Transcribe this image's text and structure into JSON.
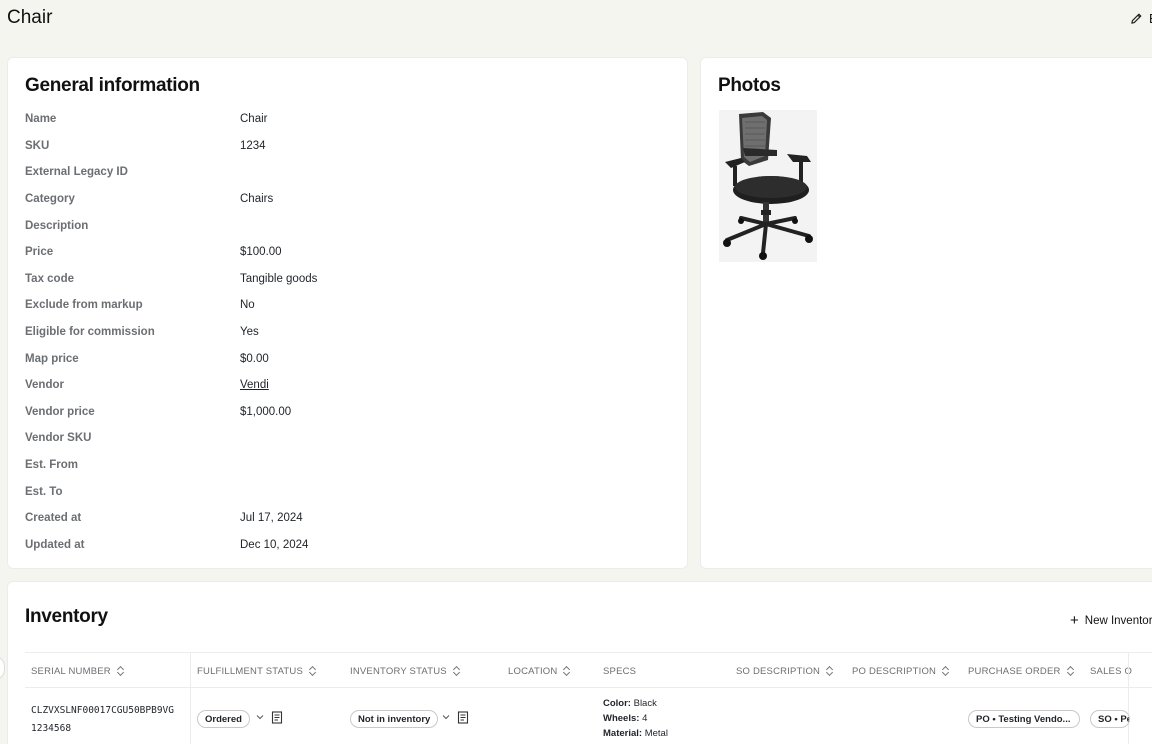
{
  "page": {
    "title": "Chair",
    "edit_label": "E"
  },
  "general": {
    "heading": "General information",
    "rows": [
      {
        "label": "Name",
        "value": "Chair"
      },
      {
        "label": "SKU",
        "value": "1234"
      },
      {
        "label": "External Legacy ID",
        "value": ""
      },
      {
        "label": "Category",
        "value": "Chairs"
      },
      {
        "label": "Description",
        "value": ""
      },
      {
        "label": "Price",
        "value": "$100.00"
      },
      {
        "label": "Tax code",
        "value": "Tangible goods"
      },
      {
        "label": "Exclude from markup",
        "value": "No"
      },
      {
        "label": "Eligible for commission",
        "value": "Yes"
      },
      {
        "label": "Map price",
        "value": "$0.00"
      },
      {
        "label": "Vendor",
        "value": "Vendi"
      },
      {
        "label": "Vendor price",
        "value": "$1,000.00"
      },
      {
        "label": "Vendor SKU",
        "value": ""
      },
      {
        "label": "Est. From",
        "value": ""
      },
      {
        "label": "Est. To",
        "value": ""
      },
      {
        "label": "Created at",
        "value": "Jul 17, 2024"
      },
      {
        "label": "Updated at",
        "value": "Dec 10, 2024"
      }
    ]
  },
  "photos": {
    "heading": "Photos"
  },
  "inventory": {
    "heading": "Inventory",
    "new_label": "New Inventor",
    "columns": [
      "Serial number",
      "Fulfillment status",
      "Inventory status",
      "Location",
      "Specs",
      "SO description",
      "PO description",
      "Purchase order",
      "Sales o"
    ],
    "row": {
      "serial_line1": "CLZVXSLNF00017CGU50BPB9VG",
      "serial_line2": "1234568",
      "fulfillment": "Ordered",
      "inventory_status": "Not in inventory",
      "specs": [
        {
          "key": "Color:",
          "value": "Black"
        },
        {
          "key": "Wheels:",
          "value": "4"
        },
        {
          "key": "Material:",
          "value": "Metal"
        }
      ],
      "purchase_order": "PO • Testing Vendo...",
      "sales_order": "SO • Pe"
    }
  },
  "colors": {
    "background": "#f5f5f0",
    "card": "#ffffff",
    "border": "#ececec",
    "label": "#6b6e72"
  }
}
